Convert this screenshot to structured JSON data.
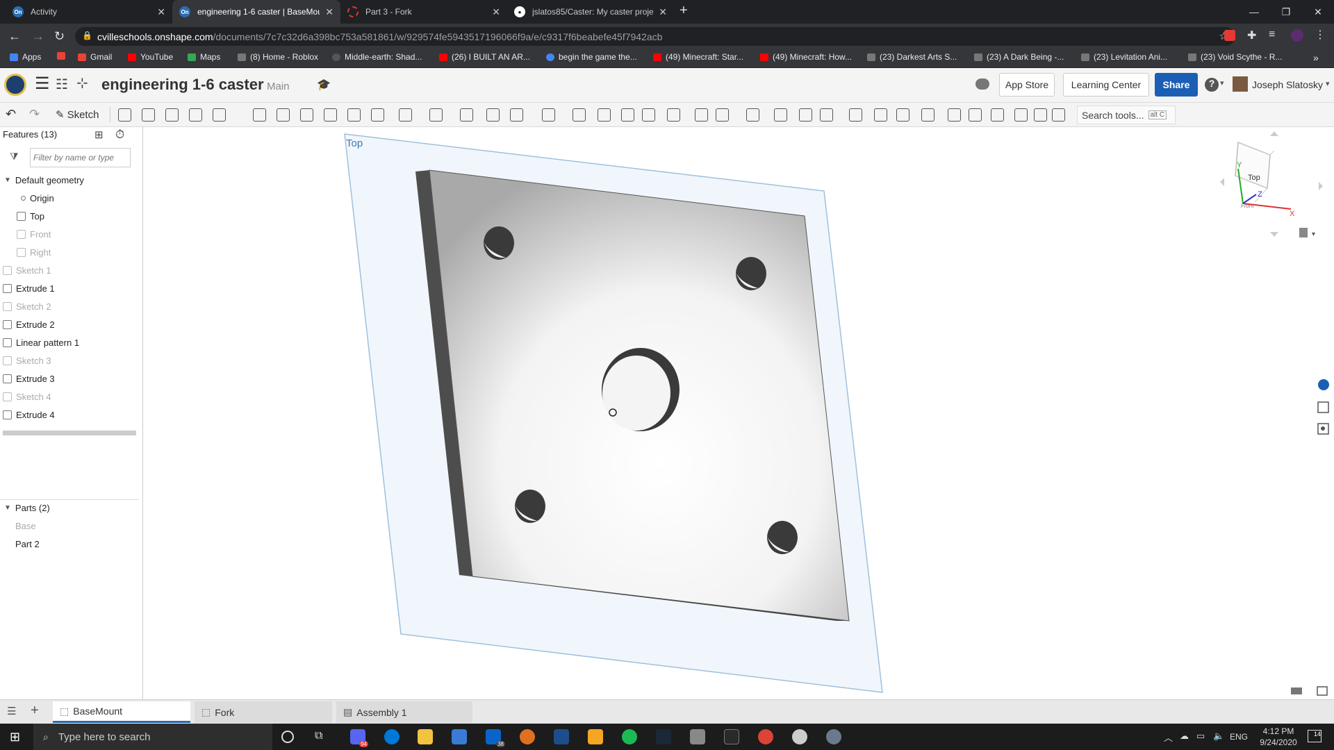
{
  "browser": {
    "tabs": [
      {
        "title": "Activity",
        "icon": "onshape-icon",
        "color": "#2b6cb0"
      },
      {
        "title": "engineering 1-6 caster | BaseMou",
        "icon": "onshape-icon",
        "color": "#2b6cb0"
      },
      {
        "title": "Part 3 - Fork",
        "icon": "loading-icon",
        "color": "#e53935"
      },
      {
        "title": "jslatos85/Caster: My caster proje",
        "icon": "github-icon",
        "color": "#ffffff"
      }
    ],
    "url_domain": "cvilleschools.onshape.com",
    "url_path": "/documents/7c7c32d6a398bc753a581861/w/929574fe5943517196066f9a/e/c9317f6beabefe45f7942acb",
    "bookmarks": [
      {
        "label": "Apps",
        "color": "#4285f4"
      },
      {
        "label": "Gmail",
        "color": "#ea4335"
      },
      {
        "label": "YouTube",
        "color": "#ff0000"
      },
      {
        "label": "Maps",
        "color": "#34a853"
      },
      {
        "label": "(8) Home - Roblox",
        "color": "#777777"
      },
      {
        "label": "Middle-earth: Shad...",
        "color": "#555555"
      },
      {
        "label": "(26) I BUILT AN AR...",
        "color": "#ff0000"
      },
      {
        "label": "begin the game the...",
        "color": "#4285f4"
      },
      {
        "label": "(49) Minecraft: Star...",
        "color": "#ff0000"
      },
      {
        "label": "(49) Minecraft: How...",
        "color": "#ff0000"
      },
      {
        "label": "(23) Darkest Arts S...",
        "color": "#777777"
      },
      {
        "label": "(23) A Dark Being -...",
        "color": "#777777"
      },
      {
        "label": "(23) Levitation Ani...",
        "color": "#777777"
      },
      {
        "label": "(23) Void Scythe - R...",
        "color": "#777777"
      }
    ]
  },
  "app": {
    "doc_title": "engineering 1-6 caster",
    "branch": "Main",
    "app_store": "App Store",
    "learning_center": "Learning Center",
    "share": "Share",
    "help": "?",
    "user": "Joseph Slatosky",
    "sketch_label": "Sketch",
    "search_tools": "Search tools...",
    "search_shortcut": "alt C",
    "accent": "#1a5fb4"
  },
  "features": {
    "header": "Features (13)",
    "filter_placeholder": "Filter by name or type",
    "group": "Default geometry",
    "items": [
      {
        "label": "Origin",
        "dim": false
      },
      {
        "label": "Top",
        "dim": false
      },
      {
        "label": "Front",
        "dim": true
      },
      {
        "label": "Right",
        "dim": true
      },
      {
        "label": "Sketch 1",
        "dim": true
      },
      {
        "label": "Extrude 1",
        "dim": false
      },
      {
        "label": "Sketch 2",
        "dim": true
      },
      {
        "label": "Extrude 2",
        "dim": false
      },
      {
        "label": "Linear pattern 1",
        "dim": false
      },
      {
        "label": "Sketch 3",
        "dim": true
      },
      {
        "label": "Extrude 3",
        "dim": false
      },
      {
        "label": "Sketch 4",
        "dim": true
      },
      {
        "label": "Extrude 4",
        "dim": false
      }
    ]
  },
  "parts": {
    "header": "Parts (2)",
    "items": [
      {
        "label": "Base",
        "dim": true
      },
      {
        "label": "Part 2",
        "dim": false
      }
    ]
  },
  "viewport": {
    "plane_label": "Top",
    "cube_face": "Top",
    "cube_front": "Front",
    "axis_x": "X",
    "axis_y": "Y",
    "axis_z": "Z"
  },
  "bottom_tabs": [
    {
      "label": "BaseMount",
      "active": true
    },
    {
      "label": "Fork",
      "active": false
    },
    {
      "label": "Assembly 1",
      "active": false
    }
  ],
  "taskbar": {
    "search_placeholder": "Type here to search",
    "lang": "ENG",
    "time": "4:12 PM",
    "date": "9/24/2020",
    "notif_count": "14",
    "mail_badge": "38",
    "discord_badge": "94"
  }
}
